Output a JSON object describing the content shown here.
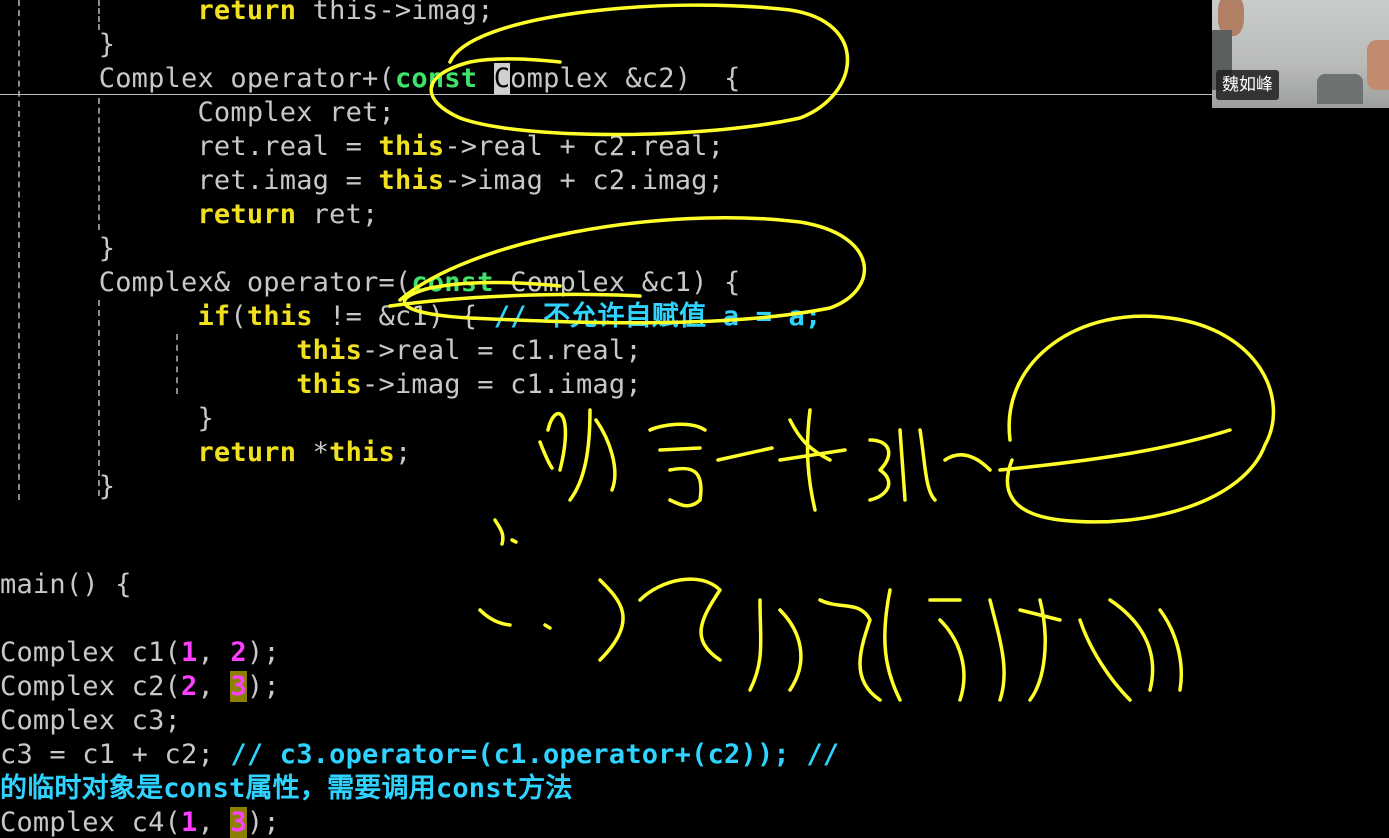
{
  "code": {
    "l1_return_imag": "return",
    "l1_rest": " this->imag;",
    "l2_brace": "}",
    "l3_a": "Complex operator+(",
    "l3_const": "const",
    "l3_cursor": "C",
    "l3_b": "omplex &c2)  {",
    "l4": "Complex ret;",
    "l5_a": "ret.real = ",
    "l5_this": "this",
    "l5_b": "->real + c2.real;",
    "l6_a": "ret.imag = ",
    "l6_this": "this",
    "l6_b": "->imag + c2.imag;",
    "l7_return": "return",
    "l7_b": " ret;",
    "l8_brace": "}",
    "l9_a": "Complex& operator=(",
    "l9_const": "const",
    "l9_b": " Complex &c1) {",
    "l10_if": "if",
    "l10_a": "(",
    "l10_this": "this",
    "l10_b": " != &c1) { ",
    "l10_comment": "// 不允许自赋值 a = a;",
    "l11_this": "this",
    "l11_b": "->real = c1.real;",
    "l12_this": "this",
    "l12_b": "->imag = c1.imag;",
    "l13_brace": "}",
    "l14_return": "return",
    "l14_a": " *",
    "l14_this": "this",
    "l14_b": ";",
    "l15_brace": "}",
    "l16_main": "main() {",
    "l17_a": "Complex c1(",
    "l17_n1": "1",
    "l17_sep": ", ",
    "l17_n2": "2",
    "l17_b": ");",
    "l18_a": "Complex c2(",
    "l18_n1": "2",
    "l18_sep": ", ",
    "l18_n2": "3",
    "l18_b": ");",
    "l19": "Complex c3;",
    "l20_a": "c3 = c1 + c2; ",
    "l20_comment": "// c3.operator=(c1.operator+(c2)); //",
    "l21_comment": "的临时对象是const属性，需要调用const方法",
    "l22_a": "Complex c4(",
    "l22_n1": "1",
    "l22_sep": ", ",
    "l22_n2": "3",
    "l22_b": ");"
  },
  "webcam": {
    "participant_name": "魏如峰"
  },
  "colors": {
    "keyword": "#f0e020",
    "type_const": "#3fe36a",
    "number": "#ff3fff",
    "comment": "#2fd3ff",
    "text": "#c8c8c8",
    "annotation_ink": "#ffff2a"
  }
}
